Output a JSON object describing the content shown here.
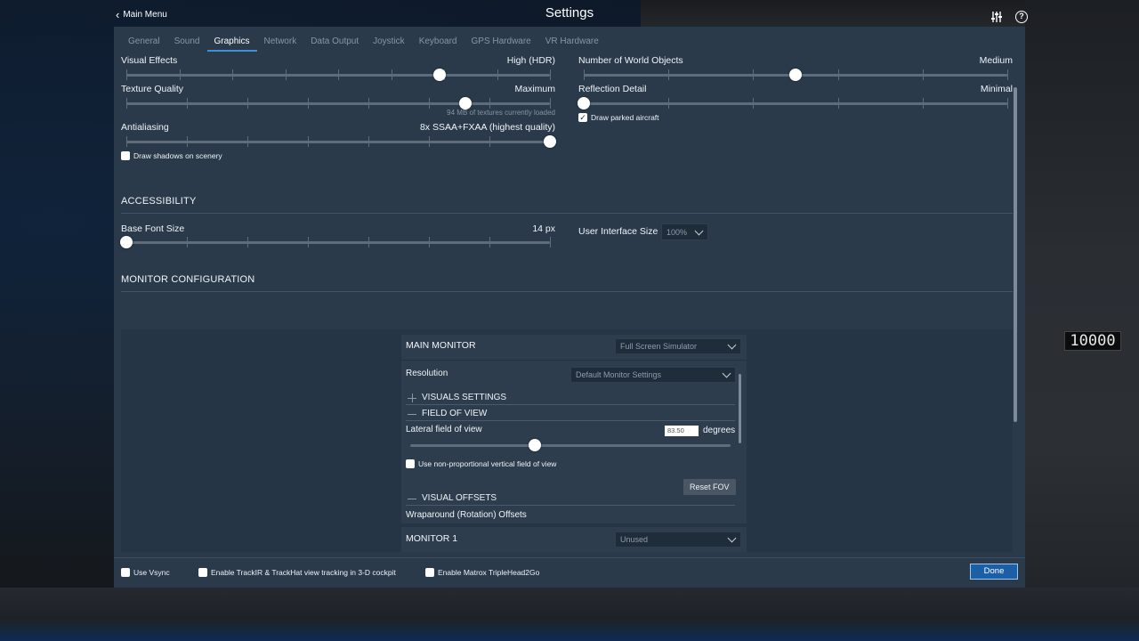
{
  "header": {
    "back_label": "Main Menu",
    "title": "Settings",
    "icons": [
      "sliders-icon",
      "help-icon"
    ],
    "help_glyph": "?"
  },
  "background": {
    "altitude_readout": "10000"
  },
  "tabs": [
    {
      "label": "General"
    },
    {
      "label": "Sound"
    },
    {
      "label": "Graphics",
      "active": true
    },
    {
      "label": "Network"
    },
    {
      "label": "Data Output"
    },
    {
      "label": "Joystick"
    },
    {
      "label": "Keyboard"
    },
    {
      "label": "GPS Hardware"
    },
    {
      "label": "VR Hardware"
    }
  ],
  "graphics": {
    "visual_effects": {
      "label": "Visual Effects",
      "value": "High (HDR)",
      "level": 0.74
    },
    "texture_quality": {
      "label": "Texture Quality",
      "value": "Maximum",
      "level": 0.8,
      "note": "94 MB of textures currently loaded"
    },
    "antialiasing": {
      "label": "Antialiasing",
      "value": "8x SSAA+FXAA (highest quality)",
      "level": 1.0
    },
    "draw_shadows": {
      "label": "Draw shadows on scenery",
      "checked": false
    },
    "world_objects": {
      "label": "Number of World Objects",
      "value": "Medium",
      "level": 0.5
    },
    "reflection_detail": {
      "label": "Reflection Detail",
      "value": "Minimal",
      "level": 0.0
    },
    "draw_parked": {
      "label": "Draw parked aircraft",
      "checked": true
    }
  },
  "accessibility": {
    "title": "ACCESSIBILITY",
    "base_font": {
      "label": "Base Font Size",
      "value": "14 px",
      "level": 0.0
    },
    "ui_size": {
      "label": "User Interface Size",
      "value": "100%"
    }
  },
  "monitor_config": {
    "title": "MONITOR CONFIGURATION",
    "main_monitor": {
      "label": "MAIN MONITOR",
      "mode": "Full Screen Simulator"
    },
    "resolution": {
      "label": "Resolution",
      "value": "Default Monitor Settings"
    },
    "visuals_settings": "VISUALS SETTINGS",
    "field_of_view": "FIELD OF VIEW",
    "lateral_fov": {
      "label": "Lateral field of view",
      "value": "83.50",
      "unit": "degrees",
      "level": 0.39
    },
    "nonprop_vfov": {
      "label": "Use non-proportional vertical field of view",
      "checked": false
    },
    "reset_fov": "Reset FOV",
    "visual_offsets": "VISUAL OFFSETS",
    "wraparound": "Wraparound (Rotation) Offsets",
    "monitor1": {
      "label": "MONITOR 1",
      "mode": "Unused"
    }
  },
  "footer": {
    "vsync": {
      "label": "Use Vsync",
      "checked": false
    },
    "trackir": {
      "label": "Enable TrackIR & TrackHat view tracking in 3-D cockpit",
      "checked": false
    },
    "matrox": {
      "label": "Enable Matrox TripleHead2Go",
      "checked": false
    },
    "done": "Done"
  },
  "colors": {
    "panel": "#2a3a4b",
    "accent": "#3d8fd6",
    "done_button": "#1b5fa6"
  }
}
